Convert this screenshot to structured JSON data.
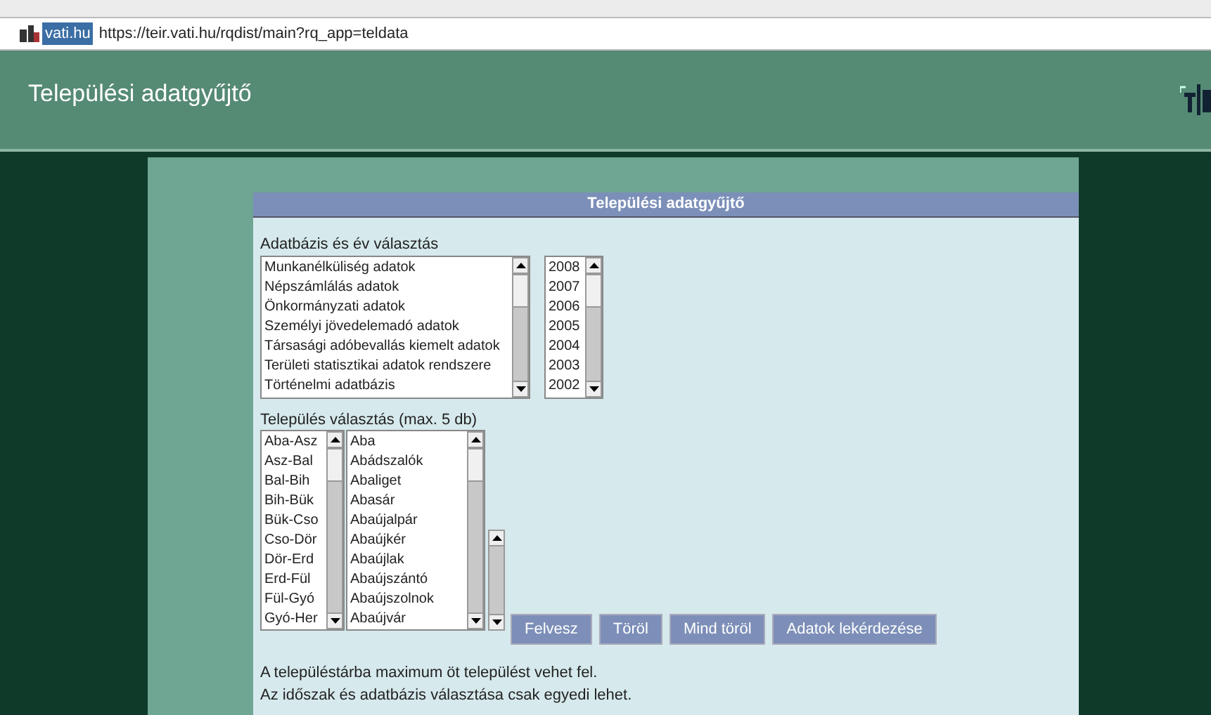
{
  "address_bar": {
    "site_badge": "vati.hu",
    "url": "https://teir.vati.hu/rqdist/main?rq_app=teldata"
  },
  "header": {
    "title": "Települési adatgyűjtő"
  },
  "panel": {
    "title": "Települési adatgyűjtő",
    "database_section": {
      "label": "Adatbázis és év választás",
      "databases": [
        "Munkanélküliség adatok",
        "Népszámlálás adatok",
        "Önkormányzati adatok",
        "Személyi jövedelemadó adatok",
        "Társasági adóbevallás kiemelt adatok",
        "Területi statisztikai adatok rendszere",
        "Történelmi adatbázis"
      ],
      "years": [
        "2008",
        "2007",
        "2006",
        "2005",
        "2004",
        "2003",
        "2002"
      ]
    },
    "settlement_section": {
      "label": "Település választás (max. 5 db)",
      "ranges": [
        "Aba-Asz",
        "Asz-Bal",
        "Bal-Bih",
        "Bih-Bük",
        "Bük-Cso",
        "Cso-Dör",
        "Dör-Erd",
        "Erd-Fül",
        "Fül-Gyó",
        "Gyó-Her"
      ],
      "settlements": [
        "Aba",
        "Abádszalók",
        "Abaliget",
        "Abasár",
        "Abaújalpár",
        "Abaújkér",
        "Abaújlak",
        "Abaújszántó",
        "Abaújszolnok",
        "Abaújvár"
      ]
    },
    "buttons": [
      "Felvesz",
      "Töröl",
      "Mind töröl",
      "Adatok lekérdezése"
    ],
    "notes": [
      "A településtárba maximum öt települést vehet fel.",
      "Az időszak és adatbázis választása csak egyedi lehet."
    ]
  }
}
